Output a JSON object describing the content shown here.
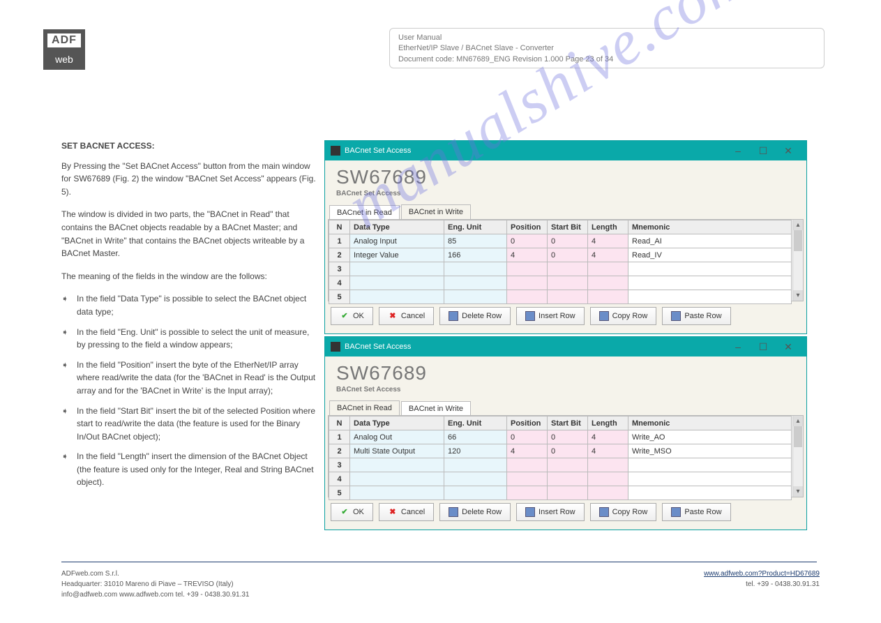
{
  "logo": {
    "top": "ADF",
    "bottom": "web"
  },
  "headerBox": {
    "line1": "User Manual",
    "line2": "EtherNet/IP Slave / BACnet Slave - Converter",
    "line3": "Document code: MN67689_ENG   Revision 1.000   Page 23 of 34"
  },
  "watermark": "manualshive.com",
  "left": {
    "title": "SET BACNET ACCESS:",
    "p1": "By Pressing the \"Set BACnet Access\" button from the main window for SW67689 (Fig. 2) the window \"BACnet Set Access\" appears (Fig. 5).",
    "p2": "The window is divided in two parts, the \"BACnet in Read\" that contains the BACnet objects readable by a BACnet Master; and \"BACnet in Write\" that contains the BACnet objects writeable by a BACnet Master.",
    "p3": "The meaning of the fields in the window are the follows:",
    "bullets": [
      "In the field \"Data Type\" is possible to select the BACnet object data type;",
      "In the field \"Eng. Unit\" is possible to select the unit of measure, by pressing to the field a window appears;",
      "In the field \"Position\" insert the byte of the EtherNet/IP array where read/write the data (for the 'BACnet in Read' is the Output array and for the 'BACnet in Write' is the Input array);",
      "In the field \"Start Bit\" insert the bit of the selected Position where start to read/write the data (the feature is used for the Binary In/Out BACnet object);",
      "In the field \"Length\" insert the dimension of the BACnet Object (the feature is used only for the Integer, Real and String BACnet object)."
    ]
  },
  "win": {
    "title": "BACnet Set Access",
    "sw": "SW67689",
    "sub": "BACnet Set Access",
    "tabRead": "BACnet in Read",
    "tabWrite": "BACnet in Write",
    "cols": {
      "n": "N",
      "dt": "Data Type",
      "eu": "Eng. Unit",
      "pos": "Position",
      "sb": "Start Bit",
      "len": "Length",
      "mn": "Mnemonic"
    },
    "readRows": [
      {
        "n": "1",
        "dt": "Analog Input",
        "eu": "85",
        "pos": "0",
        "sb": "0",
        "len": "4",
        "mn": "Read_AI"
      },
      {
        "n": "2",
        "dt": "Integer Value",
        "eu": "166",
        "pos": "4",
        "sb": "0",
        "len": "4",
        "mn": "Read_IV"
      },
      {
        "n": "3",
        "dt": "",
        "eu": "",
        "pos": "",
        "sb": "",
        "len": "",
        "mn": ""
      },
      {
        "n": "4",
        "dt": "",
        "eu": "",
        "pos": "",
        "sb": "",
        "len": "",
        "mn": ""
      },
      {
        "n": "5",
        "dt": "",
        "eu": "",
        "pos": "",
        "sb": "",
        "len": "",
        "mn": ""
      }
    ],
    "writeRows": [
      {
        "n": "1",
        "dt": "Analog Out",
        "eu": "66",
        "pos": "0",
        "sb": "0",
        "len": "4",
        "mn": "Write_AO"
      },
      {
        "n": "2",
        "dt": "Multi State Output",
        "eu": "120",
        "pos": "4",
        "sb": "0",
        "len": "4",
        "mn": "Write_MSO"
      },
      {
        "n": "3",
        "dt": "",
        "eu": "",
        "pos": "",
        "sb": "",
        "len": "",
        "mn": ""
      },
      {
        "n": "4",
        "dt": "",
        "eu": "",
        "pos": "",
        "sb": "",
        "len": "",
        "mn": ""
      },
      {
        "n": "5",
        "dt": "",
        "eu": "",
        "pos": "",
        "sb": "",
        "len": "",
        "mn": ""
      }
    ],
    "buttons": {
      "ok": "OK",
      "cancel": "Cancel",
      "del": "Delete Row",
      "ins": "Insert Row",
      "copy": "Copy Row",
      "paste": "Paste Row"
    },
    "ctrl": {
      "min": "–",
      "max": "☐",
      "close": "✕"
    }
  },
  "footer": {
    "left1": "ADFweb.com S.r.l.",
    "left2": "Headquarter: 31010 Mareno di Piave – TREVISO (Italy)",
    "left3": "info@adfweb.com     www.adfweb.com     tel. +39 - 0438.30.91.31",
    "rightLink": "www.adfweb.com?Product=HD67689",
    "right2": "tel. +39 - 0438.30.91.31"
  }
}
